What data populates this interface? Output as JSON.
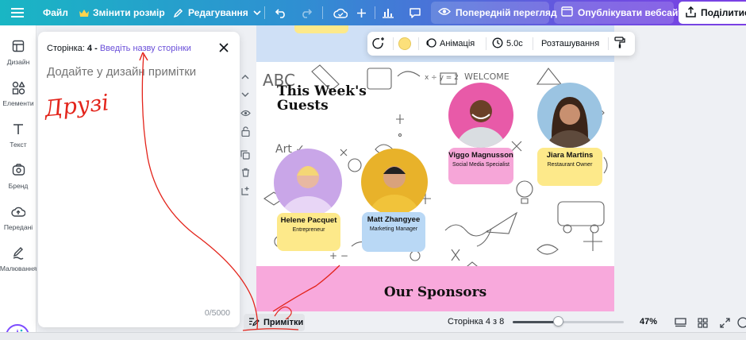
{
  "topbar": {
    "file": "Файл",
    "resize": "Змінити розмір",
    "editing": "Редагування",
    "preview": "Попередній перегляд",
    "publish": "Опублікувати вебсайт",
    "share": "Поділитися"
  },
  "sidebar": {
    "items": [
      {
        "label": "Дизайн",
        "icon": "design-icon"
      },
      {
        "label": "Елементи",
        "icon": "elements-icon"
      },
      {
        "label": "Текст",
        "icon": "text-icon"
      },
      {
        "label": "Бренд",
        "icon": "brand-icon"
      },
      {
        "label": "Передані",
        "icon": "uploads-icon"
      },
      {
        "label": "Малювання",
        "icon": "draw-icon"
      }
    ]
  },
  "notes": {
    "page_label": "Сторінка",
    "page_number": "4",
    "dash": " - ",
    "title_placeholder": "Введіть назву сторінки",
    "input_placeholder": "Додайте у дизайн примітки",
    "counter": "0/5000",
    "handwriting": "Друзі"
  },
  "context_toolbar": {
    "color": "#fce07a",
    "animation": "Анімація",
    "duration": "5.0с",
    "position": "Розташування"
  },
  "canvas": {
    "guests_title": "This Week's Guests",
    "guests": [
      {
        "name": "Helene Pacquet",
        "role": "Entrepreneur",
        "card_color": "#fde98a",
        "photo_bg": "#c9a6e8"
      },
      {
        "name": "Matt Zhangyee",
        "role": "Marketing Manager",
        "card_color": "#b9d8f5",
        "photo_bg": "#e8b22a"
      },
      {
        "name": "Viggo Magnusson",
        "role": "Social Media Specialist",
        "card_color": "#f6a6d8",
        "photo_bg": "#e85aa8"
      },
      {
        "name": "Jiara Martins",
        "role": "Restaurant Owner",
        "card_color": "#fde98a",
        "photo_bg": "#9bc4e2"
      }
    ],
    "sponsors_title": "Our Sponsors"
  },
  "bottombar": {
    "notes_button": "Примітки",
    "page_counter": "Сторінка 4 з 8",
    "zoom_fraction": 0.41,
    "zoom_label": "47%"
  },
  "colors": {
    "accent": "#7d4dff",
    "annotation": "#e3241b"
  }
}
